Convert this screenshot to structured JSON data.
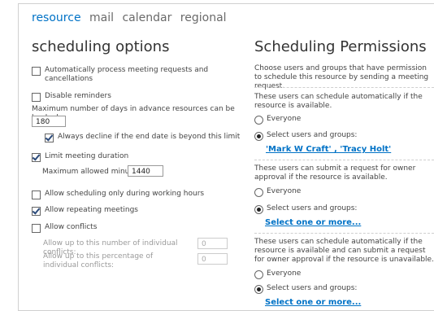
{
  "tabs": [
    "resource",
    "mail",
    "calendar",
    "regional"
  ],
  "left": {
    "title": "scheduling options",
    "auto_process": "Automatically process meeting requests and cancellations",
    "disable_reminders": "Disable reminders",
    "max_days_label": "Maximum number of days in advance resources can be booked:",
    "max_days_value": "180",
    "always_decline": "Always decline if the end date is beyond this limit",
    "limit_duration": "Limit meeting duration",
    "max_minutes_label": "Maximum allowed minutes:",
    "max_minutes_value": "1440",
    "working_hours": "Allow scheduling only during working hours",
    "repeating": "Allow repeating meetings",
    "conflicts": "Allow conflicts",
    "conflicts_number_label": "Allow up to this number of individual conflicts:",
    "conflicts_number_value": "0",
    "conflicts_percent_label": "Allow up to this percentage of individual conflicts:",
    "conflicts_percent_value": "0"
  },
  "right": {
    "title": "Scheduling Permissions",
    "intro": "Choose users and groups that have permission to schedule this resource by sending a meeting request.",
    "sec1_desc": "These users can schedule automatically if the resource is available.",
    "sec1_everyone": "Everyone",
    "sec1_select": "Select users and groups:",
    "sec1_link": "'Mark W Craft' , 'Tracy Holt'",
    "sec2_desc": "These users can submit a request for owner approval if the resource is available.",
    "sec2_everyone": "Everyone",
    "sec2_select": "Select users and groups:",
    "sec2_link": "Select one or more...",
    "sec3_desc": "These users can schedule automatically if the resource is available and can submit a request for owner approval if the resource is unavailable.",
    "sec3_everyone": "Everyone",
    "sec3_select": "Select users and groups:",
    "sec3_link": "Select one or more..."
  },
  "colors": {
    "accent": "#0072c6",
    "text": "#444444",
    "disabled": "#9a9a9a"
  }
}
